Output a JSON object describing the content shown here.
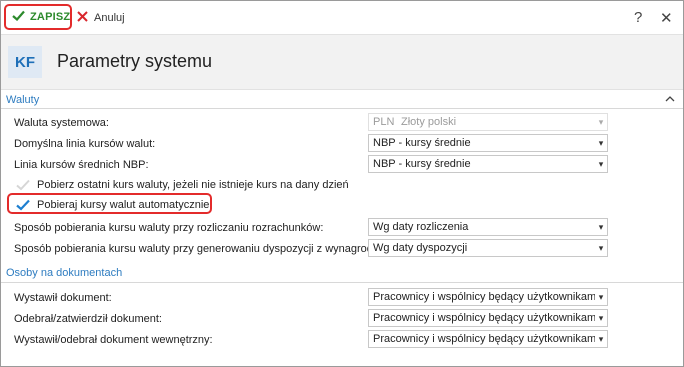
{
  "toolbar": {
    "save_label": "ZAPISZ",
    "cancel_label": "Anuluj",
    "help_label": "?",
    "close_label": "✕"
  },
  "header": {
    "badge": "KF",
    "title": "Parametry systemu"
  },
  "sections": {
    "waluty": {
      "title": "Waluty",
      "waluta_systemowa": {
        "label": "Waluta systemowa:",
        "code": "PLN",
        "value": "Złoty polski"
      },
      "domyslna_linia": {
        "label": "Domyślna linia kursów walut:",
        "value": "NBP - kursy średnie"
      },
      "linia_srednich": {
        "label": "Linia kursów średnich NBP:",
        "value": "NBP - kursy średnie"
      },
      "pobierz_ostatni": {
        "label": "Pobierz ostatni kurs waluty, jeżeli nie istnieje kurs na dany dzień",
        "checked": false
      },
      "pobieraj_auto": {
        "label": "Pobieraj kursy walut automatycznie",
        "checked": true
      },
      "sposob_rozrachunkow": {
        "label": "Sposób pobierania kursu waluty przy rozliczaniu rozrachunków:",
        "value": "Wg daty rozliczenia"
      },
      "sposob_dyspozycji": {
        "label": "Sposób pobierania kursu waluty przy generowaniu dyspozycji z wynagrodzeń:",
        "value": "Wg daty dyspozycji"
      }
    },
    "osoby": {
      "title": "Osoby na dokumentach",
      "wystawil": {
        "label": "Wystawił dokument:",
        "value": "Pracownicy i wspólnicy będący użytkownikami"
      },
      "odebral": {
        "label": "Odebrał/zatwierdził dokument:",
        "value": "Pracownicy i wspólnicy będący użytkownikami"
      },
      "wewnetrzny": {
        "label": "Wystawił/odebrał dokument wewnętrzny:",
        "value": "Pracownicy i wspólnicy będący użytkownikami"
      }
    }
  },
  "colors": {
    "accent_blue": "#2e7cc0",
    "save_green": "#2c8a2c",
    "cancel_red": "#d9262c",
    "highlight_red": "#e32b2b"
  }
}
